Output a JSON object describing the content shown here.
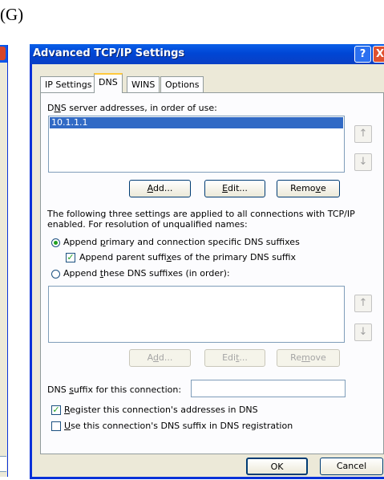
{
  "figure_label": "(G)",
  "window": {
    "title": "Advanced TCP/IP Settings",
    "help_glyph": "?",
    "close_glyph": "X"
  },
  "tabs": [
    {
      "label": "IP Settings",
      "active": false
    },
    {
      "label": "DNS",
      "active": true
    },
    {
      "label": "WINS",
      "active": false
    },
    {
      "label": "Options",
      "active": false
    }
  ],
  "dns": {
    "servers_label_pre": "D",
    "servers_label_u": "N",
    "servers_label_post": "S server addresses, in order of use:",
    "servers": [
      "10.1.1.1"
    ],
    "up_glyph": "↑",
    "down_glyph": "↓",
    "add": {
      "u": "A",
      "rest": "dd..."
    },
    "edit": {
      "u": "E",
      "rest": "dit..."
    },
    "remove": {
      "pre": "Remo",
      "u": "v",
      "post": "e"
    },
    "description_line1": "The following three settings are applied to all connections with TCP/IP",
    "description_line2": "enabled. For resolution of unqualified names:",
    "radio_primary": {
      "pre": "Append ",
      "u": "p",
      "post": "rimary and connection specific DNS suffixes",
      "selected": true
    },
    "check_parent": {
      "pre": "Append parent suffi",
      "u": "x",
      "post": "es of the primary DNS suffix",
      "checked": true
    },
    "radio_these": {
      "pre": "Append ",
      "u": "t",
      "post": "hese DNS suffixes (in order):",
      "selected": false
    },
    "suffix_add": {
      "pre": "A",
      "u": "d",
      "post": "d..."
    },
    "suffix_edit": {
      "pre": "Edi",
      "u": "t",
      "post": "..."
    },
    "suffix_remove": {
      "pre": "Re",
      "u": "m",
      "post": "ove"
    },
    "suffix_label": {
      "pre": "DNS ",
      "u": "s",
      "post": "uffix for this connection:"
    },
    "suffix_value": "",
    "check_register": {
      "u": "R",
      "post": "egister this connection's addresses in DNS",
      "checked": true
    },
    "check_use": {
      "u": "U",
      "post": "se this connection's DNS suffix in DNS registration",
      "checked": false
    }
  },
  "footer": {
    "ok": "OK",
    "cancel": "Cancel"
  },
  "colors": {
    "titlebar": "#0046d5",
    "selection": "#316ac5",
    "tab_highlight": "#ffc83c",
    "check_green": "#21a121"
  }
}
